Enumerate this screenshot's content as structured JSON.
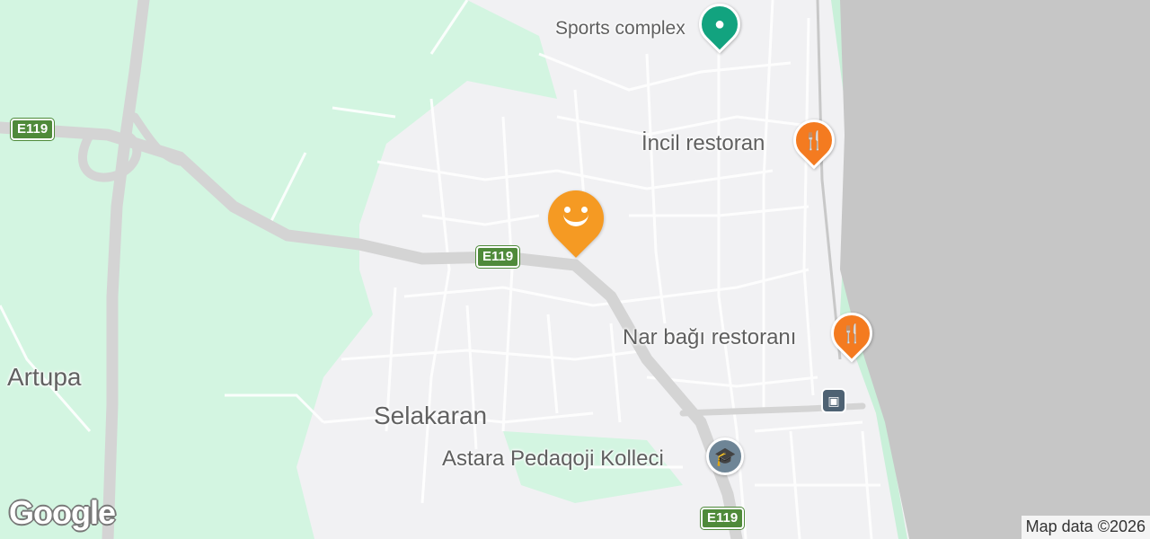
{
  "map": {
    "colors": {
      "land": "#f1f1f3",
      "green": "#d3f5e1",
      "water": "#c6c6c6",
      "highway": "#d4d4d4"
    },
    "places": [
      {
        "name": "Artupa"
      },
      {
        "name": "Selakaran"
      }
    ],
    "pois": [
      {
        "name": "Sports complex",
        "icon": "pin-icon",
        "color": "#12a37f"
      },
      {
        "name": "İncil restoran",
        "icon": "restaurant-icon",
        "color": "#f47b20"
      },
      {
        "name": "Nar bağı restoranı",
        "icon": "restaurant-icon",
        "color": "#f47b20"
      },
      {
        "name": "Astara Pedaqoji Kolleci",
        "icon": "school-icon",
        "color": "#6e8596"
      }
    ],
    "route_shields": [
      "E119",
      "E119",
      "E119"
    ],
    "bus_stop_icon": "bus-icon",
    "main_marker_icon": "smiley-icon",
    "brand": "Google",
    "attribution": "Map data ©2026"
  }
}
